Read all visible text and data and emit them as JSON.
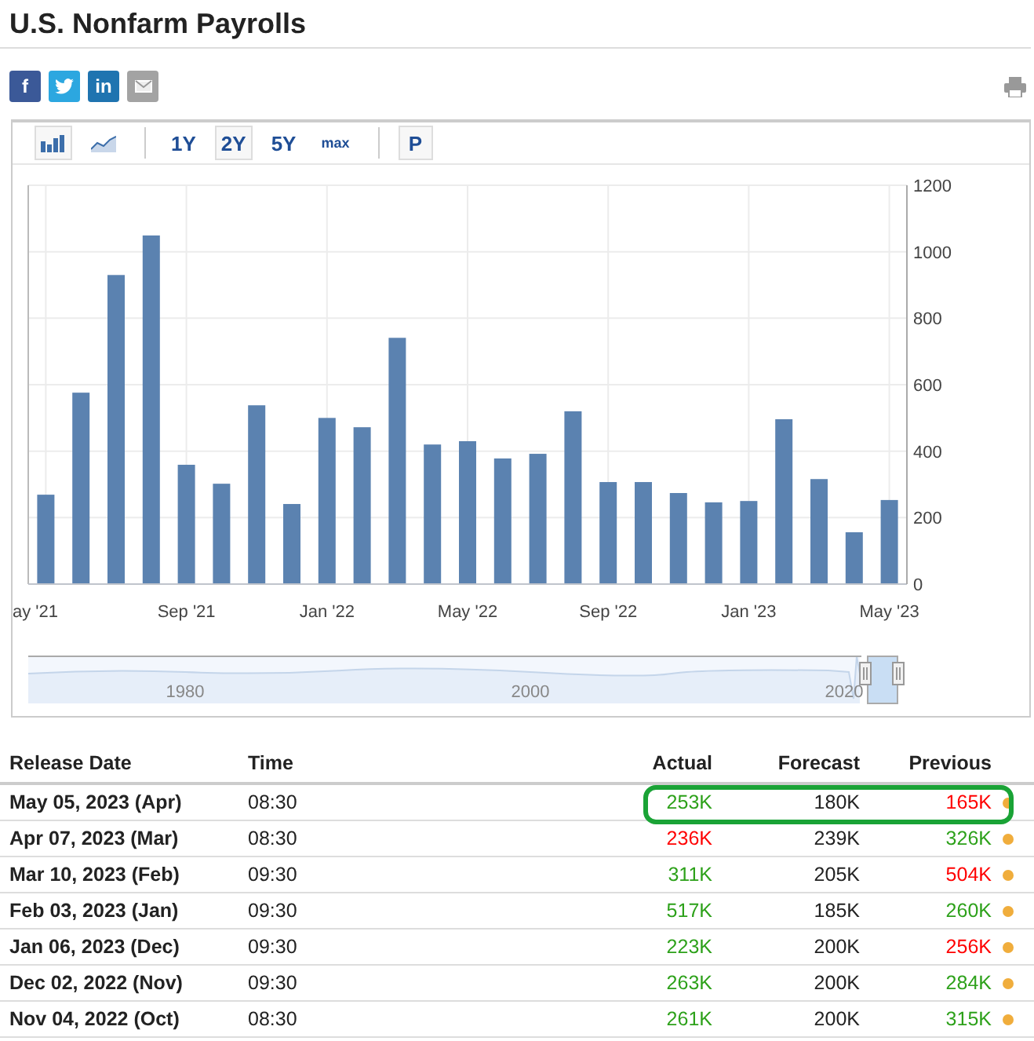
{
  "title": "U.S. Nonfarm Payrolls",
  "share_buttons": [
    {
      "kind": "facebook",
      "label": "f"
    },
    {
      "kind": "twitter"
    },
    {
      "kind": "linkedin",
      "label": "in"
    },
    {
      "kind": "email"
    }
  ],
  "toolbar": {
    "chart_types": [
      {
        "kind": "bar",
        "selected": true
      },
      {
        "kind": "line",
        "selected": false
      }
    ],
    "ranges": [
      {
        "label": "1Y",
        "selected": false
      },
      {
        "label": "2Y",
        "selected": true
      },
      {
        "label": "5Y",
        "selected": false
      },
      {
        "label": "max",
        "selected": false
      }
    ],
    "extra_button": "P"
  },
  "chart": {
    "chart_data": {
      "type": "bar",
      "categories": [
        "ay '21",
        null,
        null,
        null,
        "Sep '21",
        null,
        null,
        null,
        "Jan '22",
        null,
        null,
        null,
        "May '22",
        null,
        null,
        null,
        "Sep '22",
        null,
        null,
        null,
        "Jan '23",
        null,
        null,
        null,
        "May '23"
      ],
      "grid": true,
      "series": [
        {
          "color": "#5b82b0",
          "values": [
            269,
            576,
            930,
            1049,
            359,
            302,
            538,
            241,
            500,
            472,
            741,
            420,
            430,
            378,
            392,
            520,
            307,
            307,
            274,
            246,
            250,
            496,
            316,
            156,
            253
          ]
        }
      ],
      "ylim": [
        0,
        1200
      ],
      "yticks": [
        0,
        200,
        400,
        600,
        800,
        1000,
        1200
      ]
    },
    "navigator_labels": [
      "1980",
      "2000",
      "2020"
    ]
  },
  "table": {
    "columns": [
      "Release Date",
      "Time",
      "Actual",
      "Forecast",
      "Previous"
    ],
    "rows": [
      {
        "date": "May 05, 2023 (Apr)",
        "time": "08:30",
        "actual": "253K",
        "actual_up": true,
        "forecast": "180K",
        "previous": "165K",
        "previous_up": false,
        "highlighted": true,
        "color": "#f0ad3c"
      },
      {
        "date": "Apr 07, 2023 (Mar)",
        "time": "08:30",
        "actual": "236K",
        "actual_up": false,
        "forecast": "239K",
        "previous": "326K",
        "previous_up": true,
        "highlighted": false,
        "color": "#f0ad3c"
      },
      {
        "date": "Mar 10, 2023 (Feb)",
        "time": "09:30",
        "actual": "311K",
        "actual_up": true,
        "forecast": "205K",
        "previous": "504K",
        "previous_up": false,
        "highlighted": false,
        "color": "#f0ad3c"
      },
      {
        "date": "Feb 03, 2023 (Jan)",
        "time": "09:30",
        "actual": "517K",
        "actual_up": true,
        "forecast": "185K",
        "previous": "260K",
        "previous_up": true,
        "highlighted": false,
        "color": "#f0ad3c"
      },
      {
        "date": "Jan 06, 2023 (Dec)",
        "time": "09:30",
        "actual": "223K",
        "actual_up": true,
        "forecast": "200K",
        "previous": "256K",
        "previous_up": false,
        "highlighted": false,
        "color": "#f0ad3c"
      },
      {
        "date": "Dec 02, 2022 (Nov)",
        "time": "09:30",
        "actual": "263K",
        "actual_up": true,
        "forecast": "200K",
        "previous": "284K",
        "previous_up": true,
        "highlighted": false,
        "color": "#f0ad3c"
      },
      {
        "date": "Nov 04, 2022 (Oct)",
        "time": "08:30",
        "actual": "261K",
        "actual_up": true,
        "forecast": "200K",
        "previous": "315K",
        "previous_up": true,
        "highlighted": false,
        "color": "#f0ad3c"
      }
    ]
  }
}
